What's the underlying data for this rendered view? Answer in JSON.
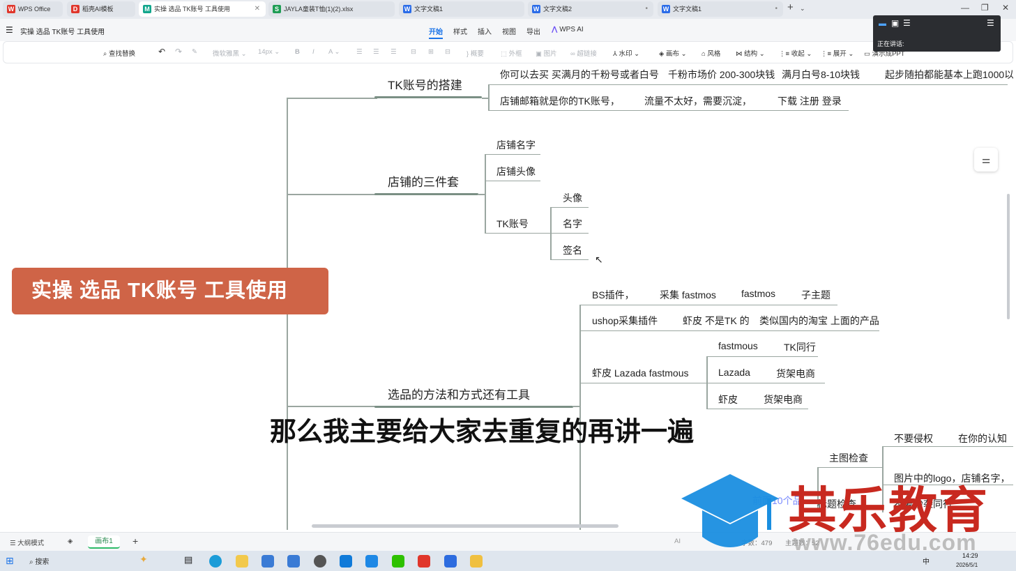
{
  "tabs": [
    {
      "label": "WPS Office",
      "icon": "W",
      "color": "#e0362b"
    },
    {
      "label": "稻壳AI模板",
      "icon": "D",
      "color": "#e0362b"
    },
    {
      "label": "实操  选品  TK账号  工具使用",
      "icon": "M",
      "color": "#12a68c"
    },
    {
      "label": "JAYLA童装T恤(1)(2).xlsx",
      "icon": "S",
      "color": "#1f9d55"
    },
    {
      "label": "文字文稿1",
      "icon": "W",
      "color": "#2b6ce8"
    },
    {
      "label": "文字文稿2",
      "icon": "W",
      "color": "#2b6ce8"
    },
    {
      "label": "文字文稿1",
      "icon": "W",
      "color": "#2b6ce8"
    }
  ],
  "doc_title": "实操  选品  TK账号  工具使用",
  "menu": [
    "开始",
    "样式",
    "插入",
    "视图",
    "导出",
    "WPS AI"
  ],
  "toolbar": {
    "find_replace": "查找替换",
    "font": "微软雅黑",
    "size": "14px",
    "summary": "概要",
    "outer_frame": "外框",
    "picture": "图片",
    "hyperlink": "超链接",
    "watermark": "水印",
    "canvas": "画布",
    "style": "风格",
    "structure": "结构",
    "collapse": "收起",
    "expand": "展开",
    "ppt": "演示成PPT"
  },
  "presenter": {
    "speaking": "正在讲话:"
  },
  "mindmap": {
    "banner": "实操  选品  TK账号  工具使用",
    "branch1": {
      "title": "TK账号的搭建",
      "row1": [
        "你可以去买  买满月的千粉号或者白号",
        "千粉市场价 200-300块钱",
        "满月白号8-10块钱",
        "起步随拍都能基本上跑1000以"
      ],
      "row2": [
        "店铺邮箱就是你的TK账号，",
        "流量不太好，需要沉淀，",
        "下载  注册  登录"
      ]
    },
    "branch2": {
      "title": "店铺的三件套",
      "items": [
        "店铺名字",
        "店铺头像",
        "TK账号"
      ],
      "tk_sub": [
        "头像",
        "名字",
        "签名"
      ]
    },
    "branch3": {
      "title": "选品的方法和方式还有工具",
      "row1": [
        "BS插件，",
        "采集 fastmos",
        "fastmos",
        "子主题"
      ],
      "row2": [
        "ushop采集插件",
        "虾皮  不是TK 的",
        "类似国内的淘宝 上面的产品"
      ],
      "row3": "虾皮  Lazada  fastmous",
      "row3_sub": [
        [
          "fastmous",
          "TK同行"
        ],
        [
          "Lazada",
          "货架电商"
        ],
        [
          "虾皮",
          "货架电商"
        ]
      ],
      "main_image_check": "主图检查",
      "check_sub": [
        "不要侵权",
        "在你的认知",
        "图片中的logo，店铺名字，",
        "不要抄袭同行"
      ],
      "title_check": "标题检查",
      "partial": [
        "前面10个品"
      ]
    }
  },
  "subtitle": "那么我主要给大家去重复的再讲一遍",
  "statusbar": {
    "outline": "大纲模式",
    "canvas_tab": "画布1",
    "ai": "AI",
    "word_count": "字数：479",
    "topic_count": "主题数：52"
  },
  "taskbar": {
    "search": "搜索",
    "time": "14:29",
    "date": "2026/5/1",
    "lang": "中"
  },
  "watermark": {
    "brand": "其乐教育",
    "url": "www.76edu.com"
  }
}
